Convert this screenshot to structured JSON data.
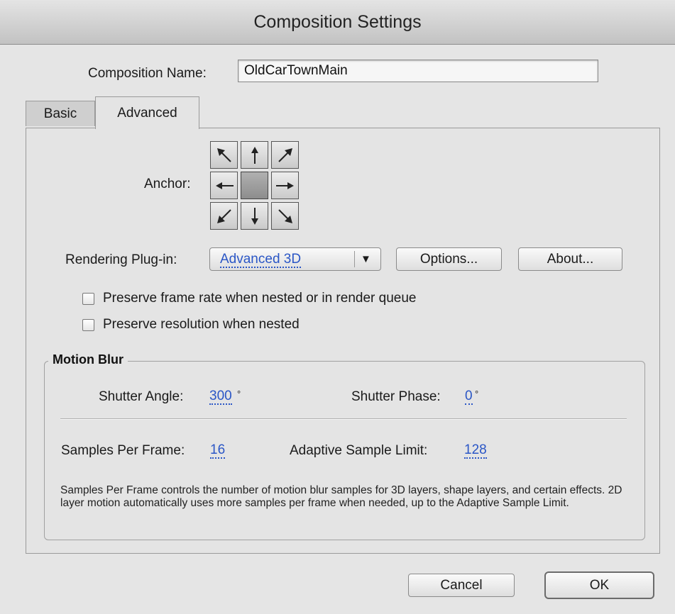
{
  "window": {
    "title": "Composition Settings"
  },
  "comp_name": {
    "label": "Composition Name:",
    "value": "OldCarTownMain"
  },
  "tabs": [
    {
      "label": "Basic",
      "active": false
    },
    {
      "label": "Advanced",
      "active": true
    }
  ],
  "anchor": {
    "label": "Anchor:",
    "buttons": [
      "arrow-up-left-icon",
      "arrow-up-icon",
      "arrow-up-right-icon",
      "arrow-left-icon",
      "center",
      "arrow-right-icon",
      "arrow-down-left-icon",
      "arrow-down-icon",
      "arrow-down-right-icon"
    ]
  },
  "rendering": {
    "label": "Rendering Plug-in:",
    "selected": "Advanced 3D",
    "dropdown_icon": "▼",
    "options_button": "Options...",
    "about_button": "About..."
  },
  "checkboxes": [
    {
      "label": "Preserve frame rate when nested or in render queue",
      "checked": false
    },
    {
      "label": "Preserve resolution when nested",
      "checked": false
    }
  ],
  "motion_blur": {
    "title": "Motion Blur",
    "shutter_angle_label": "Shutter Angle:",
    "shutter_angle_value": "300",
    "shutter_phase_label": "Shutter Phase:",
    "shutter_phase_value": "0",
    "degree_symbol": "°",
    "samples_label": "Samples Per Frame:",
    "samples_value": "16",
    "adaptive_label": "Adaptive Sample Limit:",
    "adaptive_value": "128",
    "description": "Samples Per Frame controls the number of motion blur samples for 3D layers, shape layers, and certain effects. 2D layer motion automatically uses more samples per frame when needed, up to the Adaptive Sample Limit."
  },
  "footer": {
    "cancel": "Cancel",
    "ok": "OK"
  },
  "colors": {
    "link_value": "#2a56c6",
    "panel_bg": "#e4e4e4"
  }
}
